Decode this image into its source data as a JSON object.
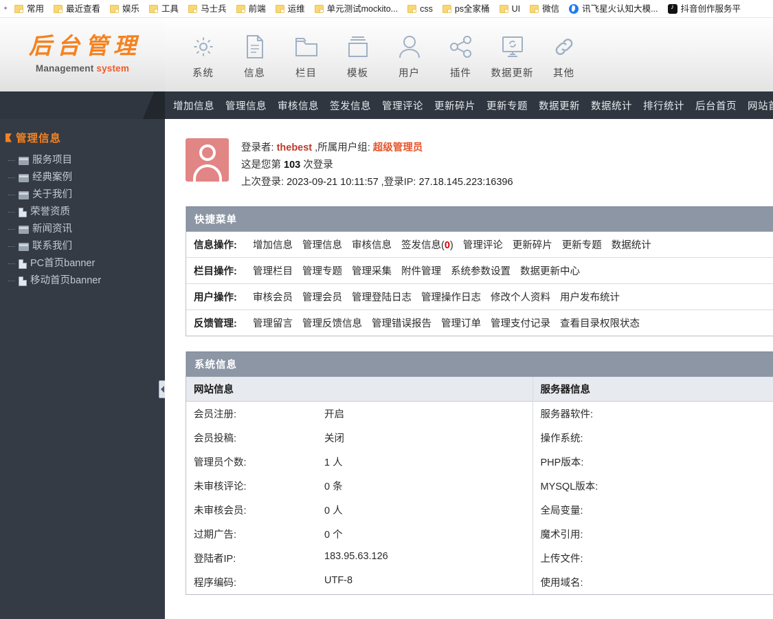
{
  "browser": {
    "bookmarks": [
      {
        "label": "常用",
        "icon": "folder-icon"
      },
      {
        "label": "最近查看",
        "icon": "folder-icon"
      },
      {
        "label": "娱乐",
        "icon": "folder-icon"
      },
      {
        "label": "工具",
        "icon": "folder-icon"
      },
      {
        "label": "马士兵",
        "icon": "folder-icon"
      },
      {
        "label": "前端",
        "icon": "folder-icon"
      },
      {
        "label": "运维",
        "icon": "folder-icon"
      },
      {
        "label": "单元测试mockito...",
        "icon": "folder-icon"
      },
      {
        "label": "css",
        "icon": "folder-icon"
      },
      {
        "label": "ps全家桶",
        "icon": "folder-icon"
      },
      {
        "label": "UI",
        "icon": "folder-icon"
      },
      {
        "label": "微信",
        "icon": "folder-icon"
      },
      {
        "label": "讯飞星火认知大模...",
        "icon": "xunfei-icon"
      },
      {
        "label": "抖音创作服务平",
        "icon": "douyin-icon"
      }
    ]
  },
  "logo": {
    "title_cn": "后台管理",
    "title_en_gray": "Management ",
    "title_en_orange": "system"
  },
  "topnav": [
    {
      "label": "系统",
      "icon": "gear-icon"
    },
    {
      "label": "信息",
      "icon": "document-icon"
    },
    {
      "label": "栏目",
      "icon": "folder-icon"
    },
    {
      "label": "模板",
      "icon": "template-icon"
    },
    {
      "label": "用户",
      "icon": "user-icon"
    },
    {
      "label": "插件",
      "icon": "share-icon"
    },
    {
      "label": "数据更新",
      "icon": "monitor-refresh-icon"
    },
    {
      "label": "其他",
      "icon": "link-icon"
    }
  ],
  "navstrip": [
    "增加信息",
    "管理信息",
    "审核信息",
    "签发信息",
    "管理评论",
    "更新碎片",
    "更新专题",
    "数据更新",
    "数据统计",
    "排行统计",
    "后台首页",
    "网站首"
  ],
  "sidebar": {
    "title": "管理信息",
    "items": [
      {
        "label": "服务项目",
        "icon": "folder-icon"
      },
      {
        "label": "经典案例",
        "icon": "folder-icon"
      },
      {
        "label": "关于我们",
        "icon": "folder-icon"
      },
      {
        "label": "荣誉资质",
        "icon": "file-icon"
      },
      {
        "label": "新闻资讯",
        "icon": "folder-icon"
      },
      {
        "label": "联系我们",
        "icon": "folder-icon"
      },
      {
        "label": "PC首页banner",
        "icon": "file-icon"
      },
      {
        "label": "移动首页banner",
        "icon": "file-icon"
      }
    ]
  },
  "userinfo": {
    "login_label": "登录者:",
    "username": "thebest",
    "group_label": ",所属用户组:",
    "group": "超级管理员",
    "count_prefix": "这是您第",
    "count": "103",
    "count_suffix": "次登录",
    "last_login_label": "上次登录:",
    "last_login_time": "2023-09-21 10:11:57",
    "ip_label": ",登录IP:",
    "ip_value": "27.18.145.223:16396"
  },
  "quickmenu": {
    "title": "快捷菜单",
    "rows": [
      {
        "label": "信息操作:",
        "links": [
          {
            "text": "增加信息"
          },
          {
            "text": "管理信息"
          },
          {
            "text": "审核信息"
          },
          {
            "text": "签发信息(",
            "badge": "0",
            "suffix": ")"
          },
          {
            "text": "管理评论"
          },
          {
            "text": "更新碎片"
          },
          {
            "text": "更新专题"
          },
          {
            "text": "数据统计"
          }
        ]
      },
      {
        "label": "栏目操作:",
        "links": [
          {
            "text": "管理栏目"
          },
          {
            "text": "管理专题"
          },
          {
            "text": "管理采集"
          },
          {
            "text": "附件管理"
          },
          {
            "text": "系统参数设置"
          },
          {
            "text": "数据更新中心"
          }
        ]
      },
      {
        "label": "用户操作:",
        "links": [
          {
            "text": "审核会员"
          },
          {
            "text": "管理会员"
          },
          {
            "text": "管理登陆日志"
          },
          {
            "text": "管理操作日志"
          },
          {
            "text": "修改个人资料"
          },
          {
            "text": "用户发布统计"
          }
        ]
      },
      {
        "label": "反馈管理:",
        "links": [
          {
            "text": "管理留言"
          },
          {
            "text": "管理反馈信息"
          },
          {
            "text": "管理错误报告"
          },
          {
            "text": "管理订单"
          },
          {
            "text": "管理支付记录"
          },
          {
            "text": "查看目录权限状态"
          }
        ]
      }
    ]
  },
  "sysinfo": {
    "title": "系统信息",
    "left_head": "网站信息",
    "right_head": "服务器信息",
    "left_rows": [
      {
        "k": "会员注册:",
        "v": "开启"
      },
      {
        "k": "会员投稿:",
        "v": "关闭"
      },
      {
        "k": "管理员个数:",
        "v": "1 人"
      },
      {
        "k": "未审核评论:",
        "v": "0 条"
      },
      {
        "k": "未审核会员:",
        "v": "0 人"
      },
      {
        "k": "过期广告:",
        "v": "0 个"
      },
      {
        "k": "登陆者IP:",
        "v": "183.95.63.126"
      },
      {
        "k": "程序编码:",
        "v": "UTF-8"
      }
    ],
    "right_rows": [
      {
        "k": "服务器软件:",
        "v": ""
      },
      {
        "k": "操作系统:",
        "v": ""
      },
      {
        "k": "PHP版本:",
        "v": ""
      },
      {
        "k": "MYSQL版本:",
        "v": ""
      },
      {
        "k": "全局变量:",
        "v": ""
      },
      {
        "k": "魔术引用:",
        "v": ""
      },
      {
        "k": "上传文件:",
        "v": ""
      },
      {
        "k": "使用域名:",
        "v": ""
      }
    ]
  },
  "colors": {
    "brand_orange": "#f58220",
    "nav_dark": "#2f3640",
    "sidebar_dark": "#343b45",
    "panel_head": "#8d96a5",
    "avatar": "#e28585",
    "accent_red": "#d40000"
  }
}
